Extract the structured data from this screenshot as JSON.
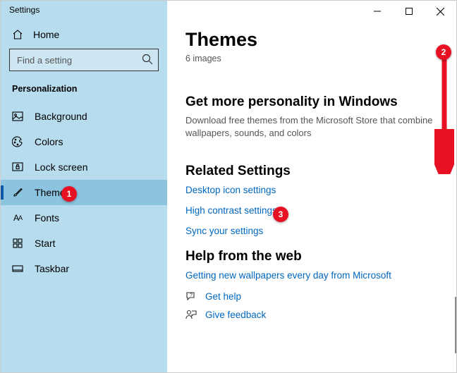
{
  "window": {
    "title": "Settings"
  },
  "sidebar": {
    "home": "Home",
    "search_placeholder": "Find a setting",
    "category": "Personalization",
    "items": [
      {
        "label": "Background"
      },
      {
        "label": "Colors"
      },
      {
        "label": "Lock screen"
      },
      {
        "label": "Themes"
      },
      {
        "label": "Fonts"
      },
      {
        "label": "Start"
      },
      {
        "label": "Taskbar"
      }
    ]
  },
  "main": {
    "heading": "Themes",
    "subheading": "6 images",
    "more_heading": "Get more personality in Windows",
    "more_body": "Download free themes from the Microsoft Store that combine wallpapers, sounds, and colors",
    "related_heading": "Related Settings",
    "related_links": [
      "Desktop icon settings",
      "High contrast settings",
      "Sync your settings"
    ],
    "help_heading": "Help from the web",
    "help_links": [
      "Getting new wallpapers every day from Microsoft"
    ],
    "support_links": [
      "Get help",
      "Give feedback"
    ]
  },
  "annotations": {
    "b1": "1",
    "b2": "2",
    "b3": "3"
  }
}
